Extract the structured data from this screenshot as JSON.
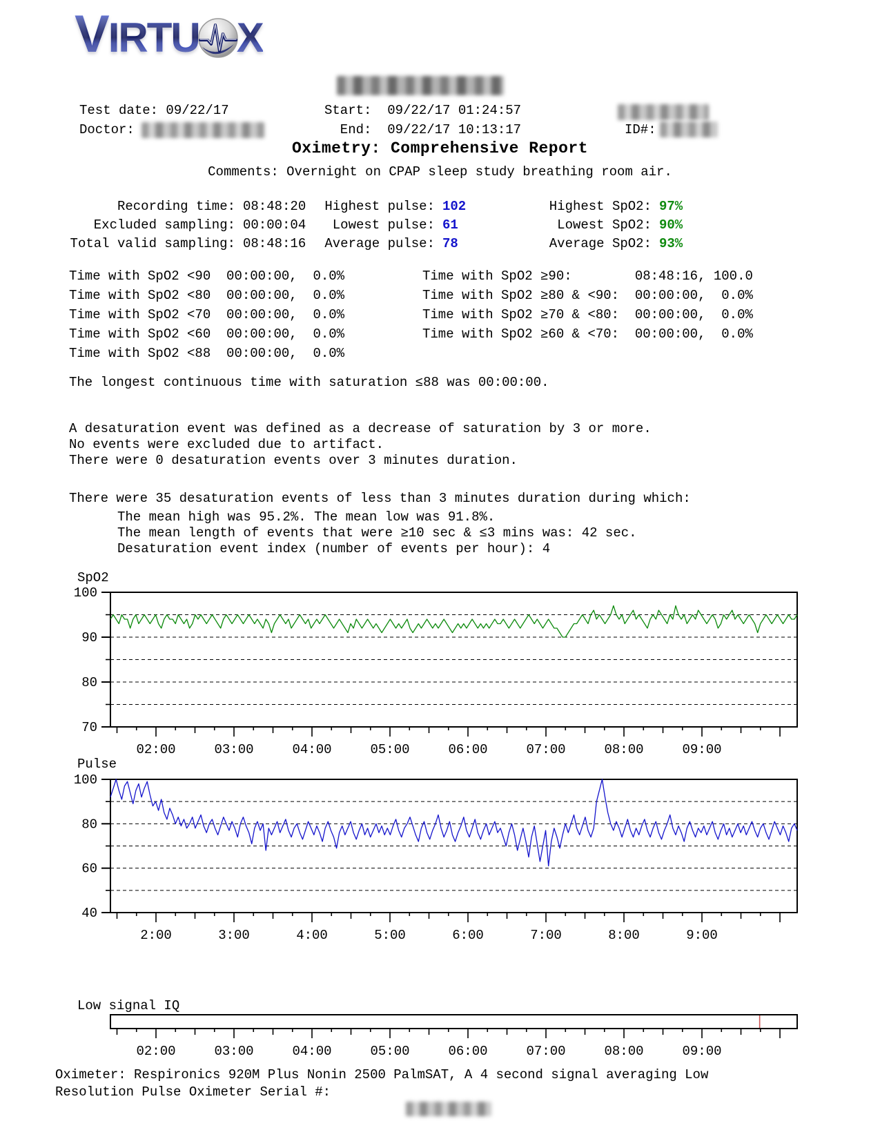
{
  "logo": {
    "text_left": "VIRTU",
    "text_right": "X"
  },
  "header": {
    "test_date_line": "Test date: 09/22/17",
    "doctor_label": "Doctor:",
    "start_line": "Start:  09/22/17 01:24:57",
    "end_line": "  End:  09/22/17 10:13:17",
    "id_label": "ID#:"
  },
  "title": "Oximetry: Comprehensive Report",
  "comments": "Comments: Overnight on CPAP sleep study breathing room air.",
  "stats": {
    "col1": [
      {
        "label": "Recording time:",
        "value": "08:48:20"
      },
      {
        "label": "Excluded sampling:",
        "value": "00:00:04"
      },
      {
        "label": "Total valid sampling:",
        "value": "08:48:16"
      }
    ],
    "col2": [
      {
        "label": "Highest pulse:",
        "value": "102"
      },
      {
        "label": "Lowest pulse:",
        "value": "61"
      },
      {
        "label": "Average pulse:",
        "value": "78"
      }
    ],
    "col3": [
      {
        "label": "Highest SpO2:",
        "value": "97%"
      },
      {
        "label": "Lowest SpO2:",
        "value": "90%"
      },
      {
        "label": "Average SpO2:",
        "value": "93%"
      }
    ]
  },
  "spo2_time_table": {
    "left": [
      "Time with SpO2 <90  00:00:00,  0.0%",
      "Time with SpO2 <80  00:00:00,  0.0%",
      "Time with SpO2 <70  00:00:00,  0.0%",
      "Time with SpO2 <60  00:00:00,  0.0%",
      "Time with SpO2 <88  00:00:00,  0.0%"
    ],
    "right": [
      "Time with SpO2 ≥90:        08:48:16, 100.0",
      "Time with SpO2 ≥80 & <90:  00:00:00,  0.0%",
      "Time with SpO2 ≥70 & <80:  00:00:00,  0.0%",
      "Time with SpO2 ≥60 & <70:  00:00:00,  0.0%"
    ]
  },
  "narrative": {
    "longest": "The longest continuous time with saturation ≤88 was 00:00:00.",
    "para1": [
      "A desaturation event was defined as a decrease of saturation by 3 or more.",
      "No events were excluded due to artifact.",
      "There were 0 desaturation events over 3 minutes duration."
    ],
    "para2_intro": "There were 35 desaturation events of less than 3 minutes duration during which:",
    "para2_lines": [
      "The mean high was 95.2%. The mean low was 91.8%.",
      "The mean length of events that were ≥10 sec & ≤3 mins was: 42 sec.",
      "Desaturation event index (number of events per hour): 4"
    ]
  },
  "footer": {
    "oximeter_text": "Oximeter: Respironics 920M Plus  Nonin 2500 PalmSAT, A 4 second signal averaging Low Resolution Pulse Oximeter Serial #:"
  },
  "chart_data": [
    {
      "type": "line",
      "id": "spo2",
      "title": "SpO2",
      "color": "#0d8a0d",
      "ylim": [
        70,
        100
      ],
      "yticks_labeled": [
        100,
        90,
        80,
        70
      ],
      "ygrid_dashed": [
        95,
        90,
        85,
        80,
        75
      ],
      "x_start_hours": 1.416,
      "x_end_hours": 10.221,
      "xtick_hours": [
        2,
        3,
        4,
        5,
        6,
        7,
        8,
        9
      ],
      "xtick_labels": [
        "02:00",
        "03:00",
        "04:00",
        "05:00",
        "06:00",
        "07:00",
        "08:00",
        "09:00"
      ],
      "values": [
        94,
        95,
        94,
        93,
        95,
        94,
        94,
        92,
        94,
        95,
        93,
        94,
        95,
        94,
        93,
        94,
        95,
        93,
        92,
        94,
        95,
        94,
        94,
        93,
        95,
        94,
        93,
        94,
        92,
        93,
        95,
        94,
        95,
        94,
        93,
        94,
        95,
        94,
        93,
        92,
        94,
        95,
        94,
        93,
        94,
        95,
        94,
        93,
        94,
        95,
        94,
        93,
        94,
        93,
        92,
        94,
        93,
        91,
        93,
        94,
        95,
        94,
        93,
        94,
        92,
        93,
        94,
        95,
        94,
        93,
        94,
        92,
        93,
        94,
        93,
        94,
        95,
        94,
        93,
        92,
        93,
        94,
        93,
        92,
        91,
        93,
        92,
        94,
        93,
        92,
        93,
        94,
        93,
        92,
        93,
        92,
        91,
        92,
        93,
        94,
        93,
        92,
        93,
        92,
        93,
        94,
        92,
        91,
        92,
        93,
        92,
        93,
        94,
        93,
        92,
        93,
        92,
        93,
        94,
        93,
        92,
        91,
        92,
        93,
        92,
        93,
        92,
        93,
        94,
        93,
        92,
        93,
        92,
        93,
        92,
        93,
        94,
        93,
        93,
        94,
        93,
        92,
        93,
        94,
        93,
        92,
        93,
        94,
        95,
        94,
        93,
        94,
        93,
        92,
        93,
        94,
        93,
        92,
        92,
        91,
        90,
        90,
        91,
        92,
        93,
        93,
        94,
        95,
        94,
        93,
        95,
        96,
        94,
        95,
        94,
        93,
        94,
        95,
        97,
        95,
        94,
        95,
        93,
        94,
        95,
        96,
        94,
        95,
        94,
        93,
        92,
        94,
        95,
        94,
        96,
        95,
        94,
        93,
        95,
        94,
        97,
        95,
        94,
        95,
        93,
        94,
        95,
        94,
        96,
        95,
        94,
        93,
        94,
        95,
        94,
        92,
        93,
        95,
        94,
        95,
        96,
        94,
        95,
        94,
        93,
        94,
        95,
        94,
        93,
        91,
        93,
        94,
        95,
        94,
        93,
        94,
        95,
        94,
        93,
        94,
        95,
        94,
        94,
        95
      ]
    },
    {
      "type": "line",
      "id": "pulse",
      "title": "Pulse",
      "color": "#1414cc",
      "ylim": [
        40,
        100
      ],
      "yticks_labeled": [
        100,
        80,
        60,
        40
      ],
      "ygrid_dashed": [
        90,
        80,
        70,
        60,
        50
      ],
      "x_start_hours": 1.416,
      "x_end_hours": 10.221,
      "xtick_hours": [
        2,
        3,
        4,
        5,
        6,
        7,
        8,
        9
      ],
      "xtick_labels": [
        "2:00",
        "3:00",
        "4:00",
        "5:00",
        "6:00",
        "7:00",
        "8:00",
        "9:00"
      ],
      "values": [
        92,
        96,
        100,
        95,
        91,
        97,
        99,
        94,
        89,
        95,
        98,
        92,
        96,
        99,
        93,
        88,
        90,
        86,
        91,
        85,
        82,
        87,
        84,
        80,
        83,
        79,
        82,
        78,
        80,
        83,
        78,
        81,
        84,
        79,
        76,
        80,
        82,
        78,
        75,
        79,
        83,
        80,
        77,
        81,
        78,
        74,
        80,
        83,
        79,
        76,
        71,
        78,
        81,
        77,
        80,
        68,
        78,
        75,
        78,
        81,
        76,
        79,
        82,
        77,
        74,
        78,
        80,
        76,
        73,
        77,
        81,
        78,
        75,
        79,
        76,
        72,
        78,
        81,
        77,
        74,
        69,
        76,
        79,
        75,
        78,
        81,
        76,
        73,
        77,
        80,
        75,
        78,
        74,
        77,
        80,
        76,
        79,
        75,
        78,
        75,
        79,
        82,
        77,
        74,
        78,
        80,
        83,
        79,
        75,
        72,
        78,
        81,
        76,
        73,
        77,
        80,
        84,
        78,
        74,
        77,
        81,
        75,
        72,
        76,
        79,
        83,
        77,
        74,
        78,
        82,
        76,
        73,
        77,
        80,
        75,
        78,
        81,
        76,
        78,
        74,
        70,
        76,
        80,
        75,
        68,
        73,
        78,
        72,
        65,
        74,
        79,
        71,
        63,
        70,
        77,
        61,
        72,
        78,
        74,
        69,
        75,
        80,
        76,
        80,
        84,
        78,
        75,
        79,
        83,
        77,
        74,
        78,
        90,
        95,
        100,
        92,
        85,
        80,
        77,
        81,
        78,
        74,
        78,
        82,
        77,
        74,
        78,
        75,
        79,
        82,
        77,
        74,
        78,
        81,
        76,
        73,
        77,
        80,
        84,
        78,
        75,
        79,
        76,
        72,
        78,
        81,
        77,
        74,
        78,
        76,
        79,
        75,
        78,
        81,
        76,
        73,
        77,
        80,
        75,
        78,
        74,
        77,
        80,
        76,
        79,
        75,
        78,
        81,
        77,
        74,
        78,
        80,
        76,
        73,
        77,
        81,
        78,
        75,
        79,
        76,
        72,
        78,
        80,
        77
      ]
    },
    {
      "type": "bar-strip",
      "id": "low-signal-iq",
      "title": "Low signal IQ",
      "x_start_hours": 1.416,
      "x_end_hours": 10.221,
      "xtick_hours": [
        2,
        3,
        4,
        5,
        6,
        7,
        8,
        9
      ],
      "xtick_labels": [
        "02:00",
        "03:00",
        "04:00",
        "05:00",
        "06:00",
        "07:00",
        "08:00",
        "09:00"
      ],
      "events_hours": [
        9.74
      ],
      "event_color": "#cc5555"
    }
  ]
}
